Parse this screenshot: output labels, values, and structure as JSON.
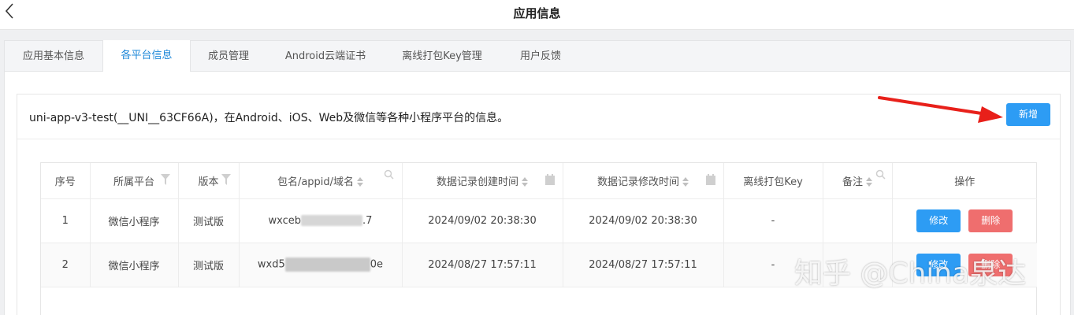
{
  "header": {
    "title": "应用信息",
    "back_icon": "chevron-left-icon"
  },
  "tabs": [
    {
      "label": "应用基本信息",
      "active": false
    },
    {
      "label": "各平台信息",
      "active": true
    },
    {
      "label": "成员管理",
      "active": false
    },
    {
      "label": "Android云端证书",
      "active": false
    },
    {
      "label": "离线打包Key管理",
      "active": false
    },
    {
      "label": "用户反馈",
      "active": false
    }
  ],
  "card": {
    "description": "uni-app-v3-test(__UNI__63CF66A)，在Android、iOS、Web及微信等各种小程序平台的信息。",
    "add_button": "新增"
  },
  "table": {
    "columns": [
      "序号",
      "所属平台",
      "版本",
      "包名/appid/域名",
      "数据记录创建时间",
      "数据记录修改时间",
      "离线打包Key",
      "备注",
      "操作"
    ],
    "rows": [
      {
        "index": "1",
        "platform": "微信小程序",
        "version": "测试版",
        "appid_prefix": "wxceb",
        "appid_suffix": ".7",
        "created": "2024/09/02 20:38:30",
        "modified": "2024/09/02 20:38:30",
        "key": "-",
        "note": ""
      },
      {
        "index": "2",
        "platform": "微信小程序",
        "version": "测试版",
        "appid_prefix": "wxd5",
        "appid_suffix": "0e",
        "created": "2024/08/27 17:57:11",
        "modified": "2024/08/27 17:57:11",
        "key": "-",
        "note": ""
      }
    ],
    "edit_label": "修改",
    "delete_label": "删除"
  },
  "colors": {
    "accent": "#2d9cf4",
    "danger": "#ef6e6e",
    "active_tab": "#1e88d8",
    "arrow": "#e8201a"
  },
  "watermark": "知乎 @China泉达"
}
